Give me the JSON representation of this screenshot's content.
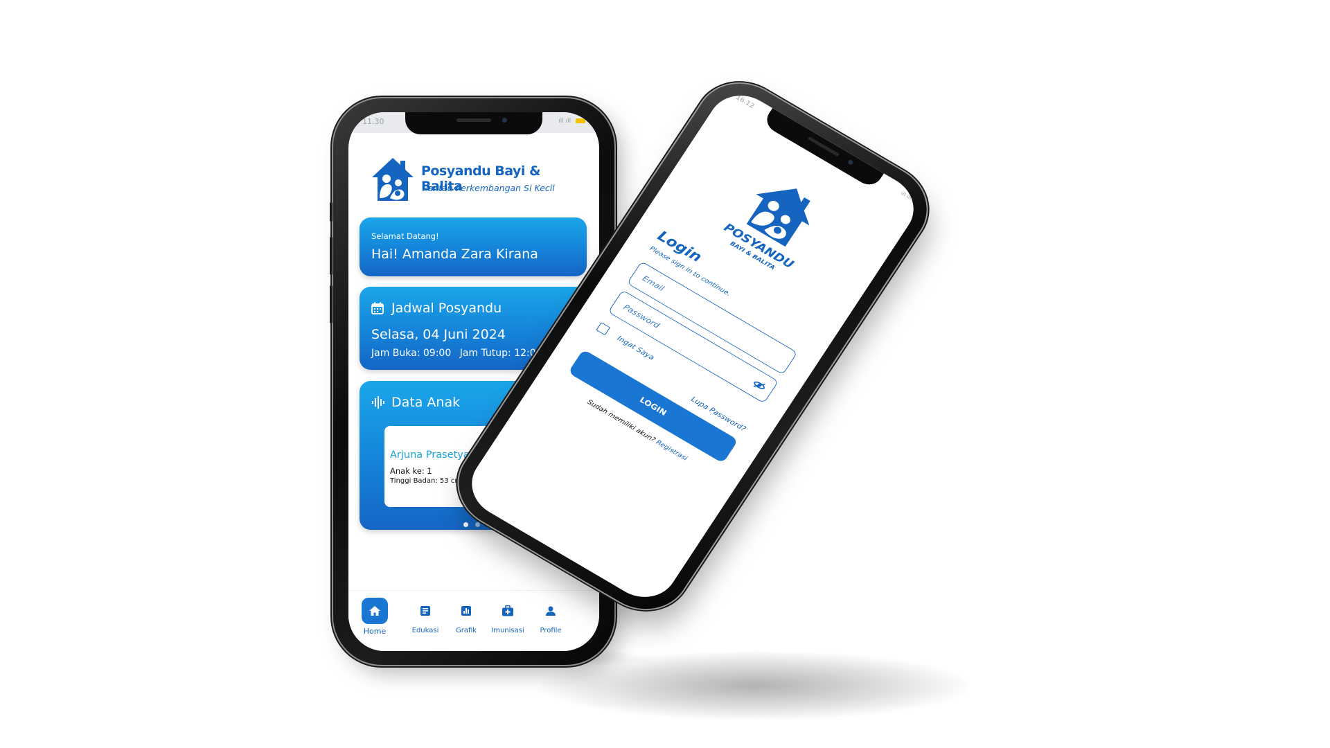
{
  "colors": {
    "primary": "#1976d2",
    "primary_dark": "#1565c0",
    "card_gradient_top": "#1aa6ea",
    "card_gradient_bottom": "#1566c4",
    "child_name": "#1ba0d8"
  },
  "left_phone": {
    "status_bar": {
      "time": "11.30",
      "icons": "ıll ıll"
    },
    "brand": {
      "title": "Posyandu Bayi & Balita",
      "subtitle": "Pantau Perkembangan Si Kecil",
      "logo_icon": "house-family-logo"
    },
    "welcome": {
      "greeting": "Selamat Datang!",
      "name": "Hai! Amanda Zara Kirana"
    },
    "schedule": {
      "icon": "calendar-icon",
      "title": "Jadwal Posyandu",
      "date": "Selasa, 04 Juni 2024",
      "open": "Jam Buka: 09:00",
      "close": "Jam Tutup: 12:00"
    },
    "children": {
      "icon": "waveform-icon",
      "title": "Data Anak",
      "items": [
        {
          "name": "Arjuna Prasetya Aditya",
          "order": "Anak ke: 1",
          "measurements": "Tinggi Badan: 53 cm - Berat Badan: 4 kg"
        }
      ],
      "page_count": 2,
      "active_page": 1
    },
    "bottom_nav": [
      {
        "label": "Home",
        "icon": "home-icon",
        "active": true
      },
      {
        "label": "Edukasi",
        "icon": "article-icon",
        "active": false
      },
      {
        "label": "Grafik",
        "icon": "bar-chart-icon",
        "active": false
      },
      {
        "label": "Imunisasi",
        "icon": "medical-kit-icon",
        "active": false
      },
      {
        "label": "Profile",
        "icon": "person-icon",
        "active": false
      }
    ]
  },
  "right_phone": {
    "status_bar": {
      "time": "16.12",
      "icons": "ıll ıll"
    },
    "brand": {
      "title": "POSYANDU",
      "subtitle": "BAYI & BALITA",
      "logo_icon": "house-family-logo"
    },
    "login": {
      "title": "Login",
      "subtitle": "Please sign in to continue.",
      "email_placeholder": "Email",
      "password_placeholder": "Password",
      "remember_label": "Ingat Saya",
      "forgot_label": "Lupa Password?",
      "button_label": "LOGIN",
      "register_prompt": "Sudah memiliki akun?",
      "register_link": "Registrasi"
    }
  }
}
